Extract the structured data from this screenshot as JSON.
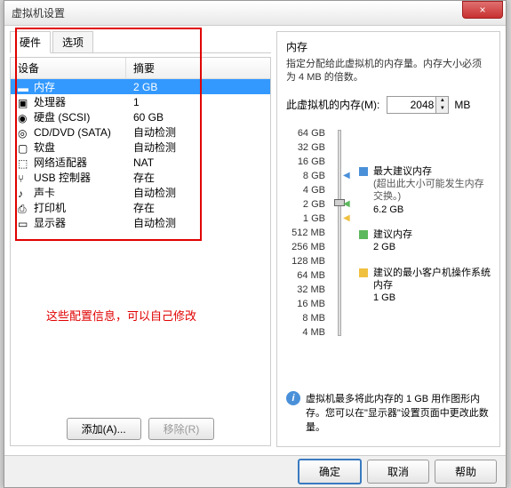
{
  "window": {
    "title": "虚拟机设置",
    "close": "×"
  },
  "tabs": {
    "hardware": "硬件",
    "options": "选项"
  },
  "table": {
    "header_device": "设备",
    "header_summary": "摘要"
  },
  "devices": [
    {
      "name": "内存",
      "summary": "2 GB",
      "icon": "memory",
      "selected": true
    },
    {
      "name": "处理器",
      "summary": "1",
      "icon": "cpu"
    },
    {
      "name": "硬盘 (SCSI)",
      "summary": "60 GB",
      "icon": "disk"
    },
    {
      "name": "CD/DVD (SATA)",
      "summary": "自动检测",
      "icon": "cd"
    },
    {
      "name": "软盘",
      "summary": "自动检测",
      "icon": "floppy"
    },
    {
      "name": "网络适配器",
      "summary": "NAT",
      "icon": "net"
    },
    {
      "name": "USB 控制器",
      "summary": "存在",
      "icon": "usb"
    },
    {
      "name": "声卡",
      "summary": "自动检测",
      "icon": "sound"
    },
    {
      "name": "打印机",
      "summary": "存在",
      "icon": "printer"
    },
    {
      "name": "显示器",
      "summary": "自动检测",
      "icon": "display"
    }
  ],
  "note": "这些配置信息，可以自己修改",
  "left_buttons": {
    "add": "添加(A)...",
    "remove": "移除(R)"
  },
  "memory": {
    "title": "内存",
    "desc": "指定分配给此虚拟机的内存量。内存大小必须为 4 MB 的倍数。",
    "input_label": "此虚拟机的内存(M):",
    "value": "2048",
    "unit": "MB",
    "ticks": [
      "64 GB",
      "32 GB",
      "16 GB",
      "8 GB",
      "4 GB",
      "2 GB",
      "1 GB",
      "512 MB",
      "256 MB",
      "128 MB",
      "64 MB",
      "32 MB",
      "16 MB",
      "8 MB",
      "4 MB"
    ],
    "legend": {
      "max": {
        "label": "最大建议内存",
        "sub": "(超出此大小可能发生内存交换。)",
        "value": "6.2 GB",
        "color": "#4a90d9"
      },
      "rec": {
        "label": "建议内存",
        "value": "2 GB",
        "color": "#5cb85c"
      },
      "min": {
        "label": "建议的最小客户机操作系统内存",
        "value": "1 GB",
        "color": "#f0c040"
      }
    },
    "info": "虚拟机最多将此内存的 1 GB 用作图形内存。您可以在\"显示器\"设置页面中更改此数量。"
  },
  "footer": {
    "ok": "确定",
    "cancel": "取消",
    "help": "帮助"
  }
}
